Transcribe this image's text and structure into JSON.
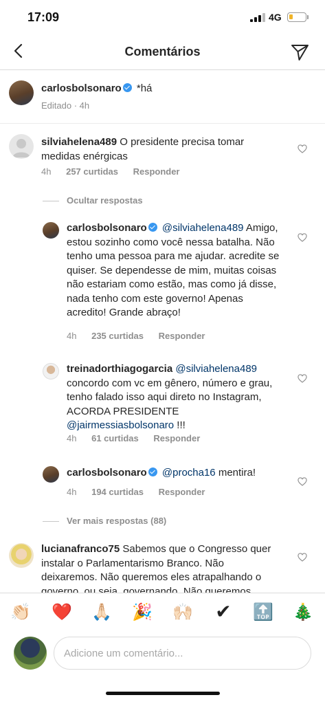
{
  "status_bar": {
    "time": "17:09",
    "network": "4G",
    "battery_color": "#f0b429"
  },
  "header": {
    "title": "Comentários",
    "back_icon": "chevron-left-icon",
    "share_icon": "paper-plane-icon"
  },
  "caption": {
    "username": "carlosbolsonaro",
    "text": "*há",
    "edited": "Editado · 4h"
  },
  "comments": [
    {
      "username": "silviahelena489",
      "text": "O presidente precisa tomar medidas enérgicas",
      "time": "4h",
      "likes": "257 curtidas",
      "reply": "Responder"
    }
  ],
  "hide_replies": "Ocultar respostas",
  "replies": [
    {
      "username": "carlosbolsonaro",
      "mention": "@silviahelena489",
      "text": "Amigo, estou sozinho como você nessa batalha. Não tenho uma pessoa para me ajudar. acredite se quiser. Se dependesse de mim, muitas coisas não estariam como estão, mas como já disse, nada tenho com este governo! Apenas acredito! Grande abraço!",
      "time": "4h",
      "likes": "235 curtidas",
      "reply": "Responder"
    },
    {
      "username": "treinadorthiagogarcia",
      "mention": "@silviahelena489",
      "text": "concordo com vc em gênero, número e grau, tenho falado isso aqui direto no Instagram, ACORDA PRESIDENTE",
      "mention2": "@jairmessiasbolsonaro",
      "text2": " !!!",
      "time": "4h",
      "likes": "61 curtidas",
      "reply": "Responder"
    },
    {
      "username": "carlosbolsonaro",
      "mention": "@procha16",
      "text": "mentira!",
      "time": "4h",
      "likes": "194 curtidas",
      "reply": "Responder"
    }
  ],
  "more_replies": "Ver mais respostas (88)",
  "last_comment": {
    "username": "lucianafranco75",
    "text": "Sabemos que o Congresso quer instalar o Parlamentarismo Branco. Não deixaremos. Não queremos eles atrapalhando o governo, ou seja, governando. Não queremos"
  },
  "emoji_bar": {
    "items": [
      "👏🏻",
      "❤️",
      "🙏🏻",
      "🎉",
      "🙌🏻",
      "✔",
      "🔝",
      "🎄"
    ]
  },
  "input": {
    "placeholder": "Adicione um comentário..."
  }
}
